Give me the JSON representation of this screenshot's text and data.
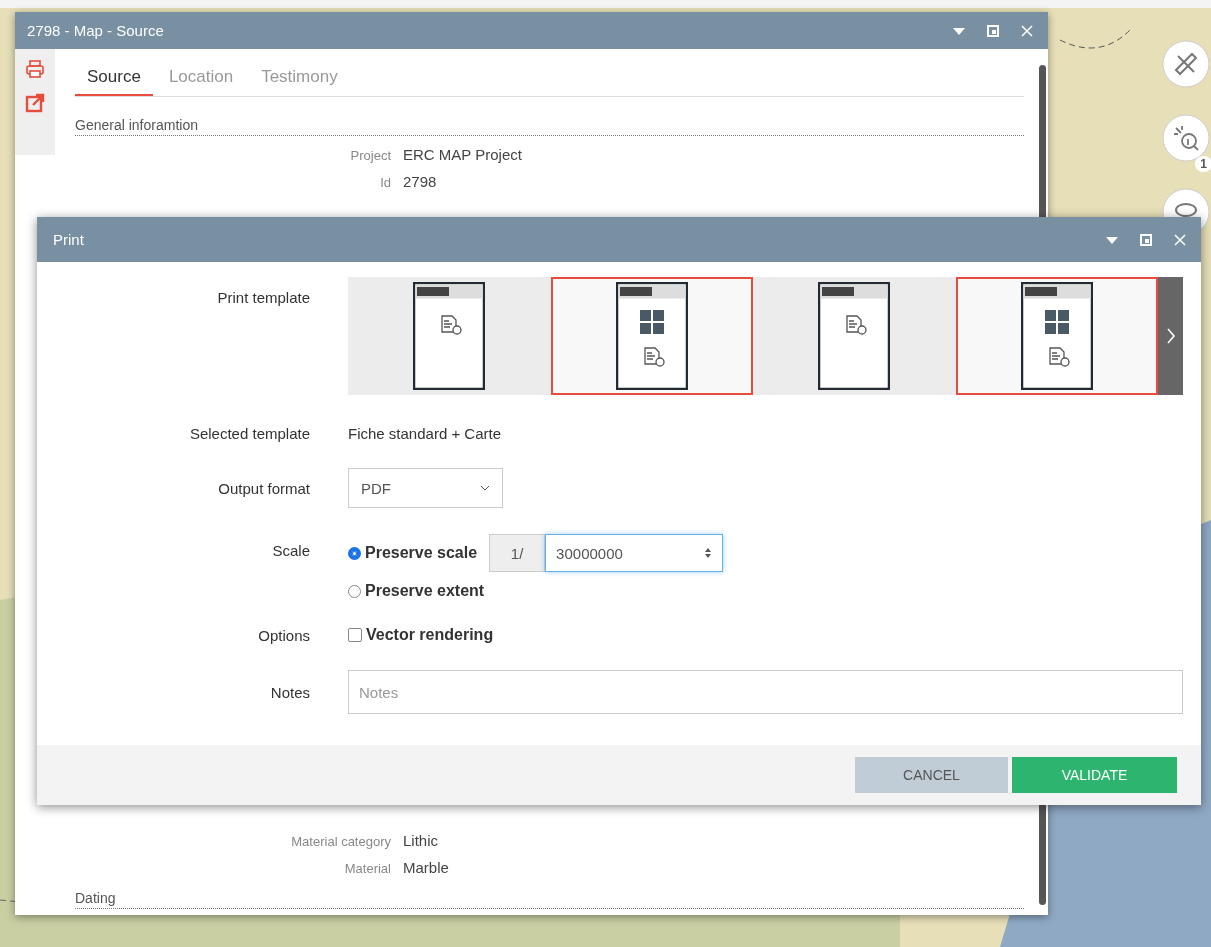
{
  "source_window": {
    "title": "2798 - Map - Source",
    "tabs": [
      {
        "label": "Source",
        "selected": true
      },
      {
        "label": "Location",
        "selected": false
      },
      {
        "label": "Testimony",
        "selected": false
      }
    ],
    "section": "General inforamtion",
    "fields": [
      {
        "label": "Project",
        "value": "ERC MAP Project"
      },
      {
        "label": "Id",
        "value": "2798"
      }
    ],
    "lower_fields": [
      {
        "label": "Material category",
        "value": "Lithic"
      },
      {
        "label": "Material",
        "value": "Marble"
      }
    ],
    "lower_section": "Dating"
  },
  "map_tools": [
    {
      "kind": "measure"
    },
    {
      "kind": "identify",
      "badge": "1"
    },
    {
      "kind": "lasso"
    }
  ],
  "print_dialog": {
    "title": "Print",
    "template_label": "Print template",
    "templates": [
      {
        "kind": "plain",
        "selected": false
      },
      {
        "kind": "map",
        "selected": true
      },
      {
        "kind": "plain",
        "selected": false
      },
      {
        "kind": "map",
        "selected": true
      }
    ],
    "selected_template_label": "Selected template",
    "selected_template": "Fiche standard + Carte",
    "output_label": "Output format",
    "output_format": "PDF",
    "scale_label": "Scale",
    "scale_options": [
      {
        "label": "Preserve scale",
        "selected": true
      },
      {
        "label": "Preserve extent",
        "selected": false
      }
    ],
    "scale_prefix": "1/",
    "scale_value": "30000000",
    "options_label": "Options",
    "vector_rendering": {
      "label": "Vector rendering",
      "checked": false
    },
    "notes_label": "Notes",
    "notes_placeholder": "Notes",
    "buttons": [
      {
        "label": "CANCEL",
        "kind": "secondary"
      },
      {
        "label": "VALIDATE",
        "kind": "primary"
      }
    ]
  }
}
